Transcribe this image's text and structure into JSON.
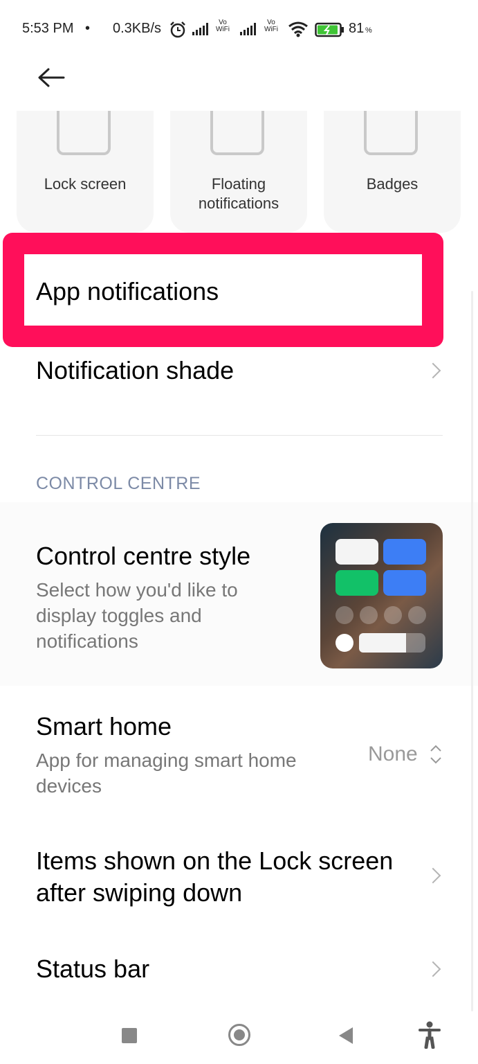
{
  "status_bar": {
    "time": "5:53 PM",
    "dot": "•",
    "speed": "0.3KB/s",
    "vowifi_1": "Vo\nWiFi",
    "vowifi_2": "Vo\nWiFi",
    "battery": "81",
    "battery_unit": "%"
  },
  "tiles": [
    {
      "label": "Lock screen"
    },
    {
      "label": "Floating notifications"
    },
    {
      "label": "Badges"
    }
  ],
  "rows": {
    "app_notifications": "App notifications",
    "notification_shade": "Notification shade",
    "section_header": "CONTROL CENTRE",
    "control_centre_style": {
      "title": "Control centre style",
      "subtitle": "Select how you'd like to display toggles and notifications"
    },
    "smart_home": {
      "title": "Smart home",
      "subtitle": "App for managing smart home devices",
      "value": "None"
    },
    "lock_screen_items": "Items shown on the Lock screen after swiping down",
    "status_bar": "Status bar"
  },
  "colors": {
    "highlight": "#ff0f5a",
    "section": "#7c8aa6",
    "preview_blue": "#3d7ef5",
    "preview_green": "#12c168"
  }
}
